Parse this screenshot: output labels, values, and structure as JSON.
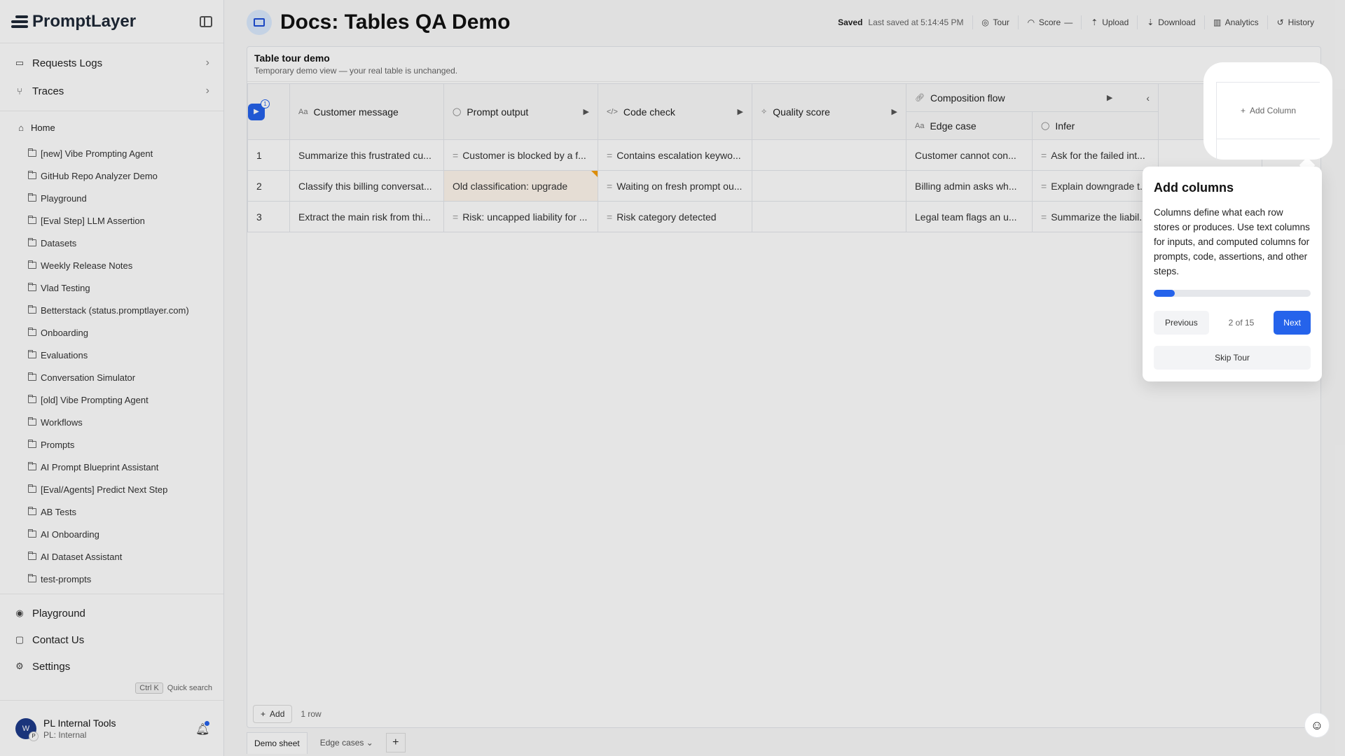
{
  "sidebar": {
    "brand": "PromptLayer",
    "top_items": [
      {
        "label": "Requests Logs",
        "icon": "monitor-icon"
      },
      {
        "label": "Traces",
        "icon": "branch-icon"
      }
    ],
    "home_label": "Home",
    "folders": [
      "[new] Vibe Prompting Agent",
      "GitHub Repo Analyzer Demo",
      "Playground",
      "[Eval Step] LLM Assertion",
      "Datasets",
      "Weekly Release Notes",
      "Vlad Testing",
      "Betterstack (status.promptlayer.com)",
      "Onboarding",
      "Evaluations",
      "Conversation Simulator",
      "[old] Vibe Prompting Agent",
      "Workflows",
      "Prompts",
      "AI Prompt Blueprint Assistant",
      "[Eval/Agents] Predict Next Step",
      "AB Tests",
      "AI Onboarding",
      "AI Dataset Assistant",
      "test-prompts"
    ],
    "bottom_items": [
      {
        "label": "Playground",
        "icon": "play-circle-icon"
      },
      {
        "label": "Contact Us",
        "icon": "message-icon"
      },
      {
        "label": "Settings",
        "icon": "gear-icon"
      }
    ],
    "quick_search": {
      "key": "Ctrl K",
      "label": "Quick search"
    },
    "user": {
      "name": "PL Internal Tools",
      "org": "PL: Internal",
      "avatar": "W",
      "avatar_sub": "P"
    }
  },
  "header": {
    "title": "Docs: Tables QA Demo",
    "saved": "Saved",
    "last_saved": "Last saved at 5:14:45 PM",
    "buttons": {
      "tour": "Tour",
      "score": "Score",
      "score_value": "—",
      "upload": "Upload",
      "download": "Download",
      "analytics": "Analytics",
      "history": "History"
    }
  },
  "panel": {
    "title": "Table tour demo",
    "subtitle": "Temporary demo view — your real table is unchanged."
  },
  "table": {
    "run_badge": "1",
    "columns": {
      "customer_message": "Customer message",
      "prompt_output": "Prompt output",
      "code_check": "Code check",
      "quality_score": "Quality score",
      "composition_flow": "Composition flow",
      "edge_case": "Edge case",
      "infer": "Infer",
      "add_column": "Add Column"
    },
    "rows": [
      {
        "num": "1",
        "message": "Summarize this frustrated cu...",
        "output": "Customer is blocked by a f...",
        "code": "Contains escalation keywo...",
        "quality": "",
        "edge": "Customer cannot con...",
        "infer": "Ask for the failed int..."
      },
      {
        "num": "2",
        "message": "Classify this billing conversat...",
        "output": "Old classification: upgrade",
        "code": "Waiting on fresh prompt ou...",
        "quality": "",
        "edge": "Billing admin asks wh...",
        "infer": "Explain downgrade t..."
      },
      {
        "num": "3",
        "message": "Extract the main risk from thi...",
        "output": "Risk: uncapped liability for ...",
        "code": "Risk category detected",
        "quality": "",
        "edge": "Legal team flags an u...",
        "infer": "Summarize the liabil..."
      }
    ]
  },
  "footer": {
    "add_label": "Add",
    "row_count": "1 row",
    "sheets": [
      "Demo sheet",
      "Edge cases"
    ]
  },
  "tour": {
    "title": "Add columns",
    "body": "Columns define what each row stores or produces. Use text columns for inputs, and computed columns for prompts, code, assertions, and other steps.",
    "progress_fraction": 0.133,
    "prev_label": "Previous",
    "step_label": "2 of 15",
    "next_label": "Next",
    "skip_label": "Skip Tour"
  },
  "colors": {
    "accent": "#2563eb",
    "stale_marker": "#f59e0b"
  }
}
